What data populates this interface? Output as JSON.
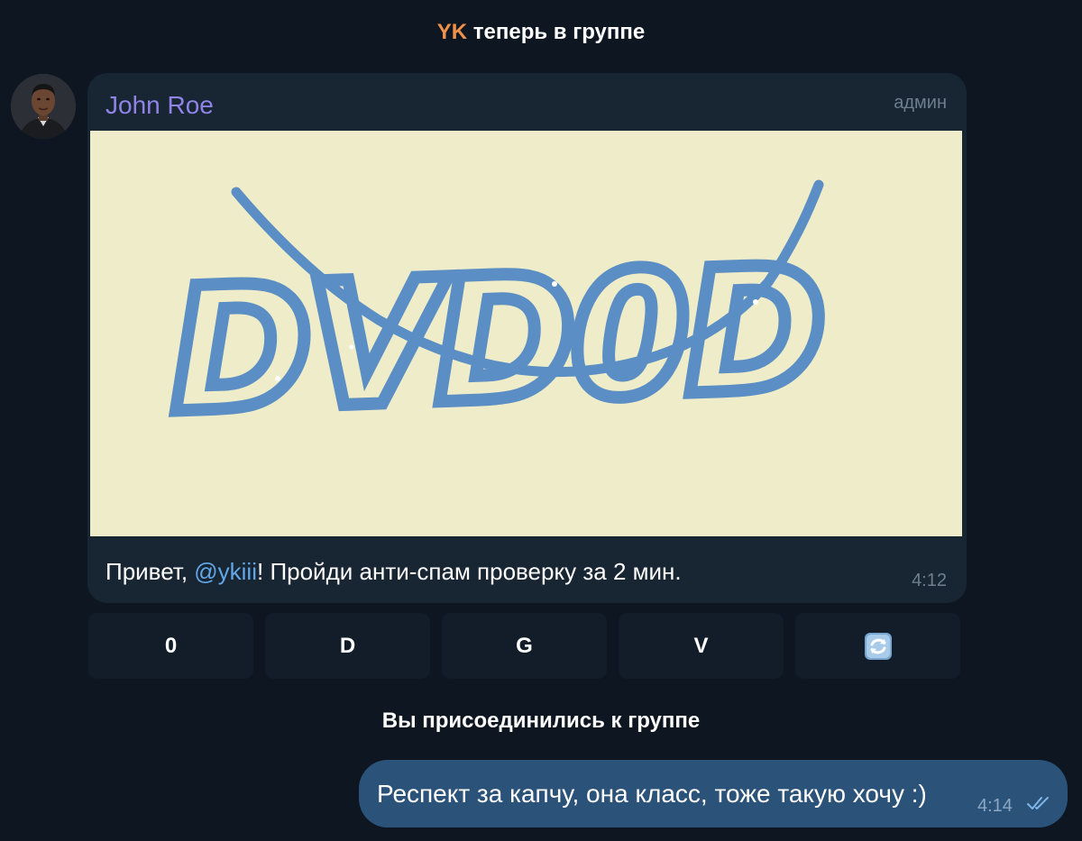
{
  "service_join": {
    "name": "YK",
    "text": "теперь в группе"
  },
  "message": {
    "sender": "John Roe",
    "role": "админ",
    "captcha_text": "DVD0D",
    "caption_prefix": "Привет, ",
    "caption_mention": "@ykiii",
    "caption_suffix": "! Пройди анти-спам проверку за 2 мин.",
    "time": "4:12"
  },
  "keyboard": {
    "buttons": [
      "0",
      "D",
      "G",
      "V"
    ],
    "refresh_icon": "refresh-icon"
  },
  "service_self": {
    "text": "Вы присоединились к группе"
  },
  "own_message": {
    "text": "Респект за капчу, она класс, тоже такую хочу :)",
    "time": "4:14",
    "status_icon": "double-check-icon"
  },
  "colors": {
    "background": "#0e1621",
    "bubble": "#182533",
    "own_bubble": "#2b5278",
    "sender_name": "#8f84e6",
    "join_name": "#f0914a",
    "mention": "#62a8e8",
    "captcha_bg": "#efedc9",
    "captcha_ink": "#5b8ec4"
  }
}
